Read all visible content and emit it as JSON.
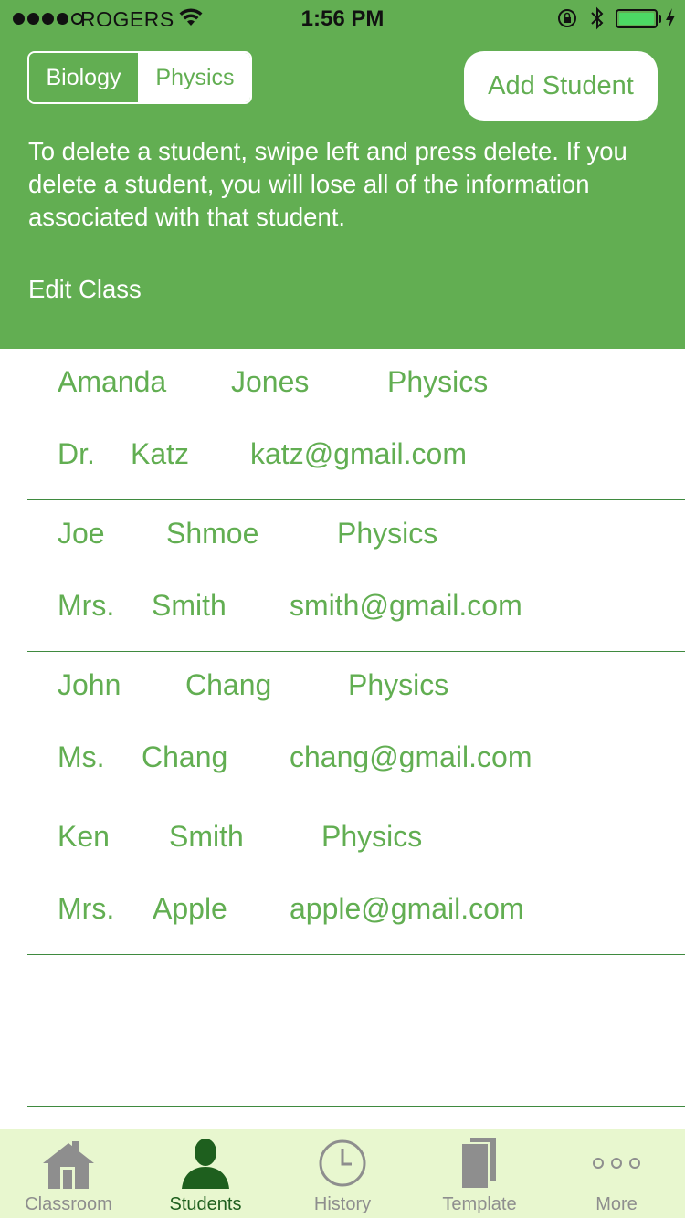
{
  "status_bar": {
    "carrier": "ROGERS",
    "time": "1:56 PM"
  },
  "segmented_control": {
    "options": [
      "Biology",
      "Physics"
    ],
    "selected": "Biology"
  },
  "header": {
    "add_button_label": "Add Student",
    "instructions": "To delete a student, swipe left and press delete. If you delete a student, you will lose all of the information associated with that student.",
    "edit_class_label": "Edit Class"
  },
  "students": [
    {
      "first_name": "Amanda",
      "last_name": "Jones",
      "class": "Physics",
      "teacher_title": "Dr.",
      "teacher_name": "Katz",
      "email": "katz@gmail.com"
    },
    {
      "first_name": "Joe",
      "last_name": "Shmoe",
      "class": "Physics",
      "teacher_title": "Mrs.",
      "teacher_name": "Smith",
      "email": "smith@gmail.com"
    },
    {
      "first_name": "John",
      "last_name": "Chang",
      "class": "Physics",
      "teacher_title": "Ms.",
      "teacher_name": "Chang",
      "email": "chang@gmail.com"
    },
    {
      "first_name": "Ken",
      "last_name": "Smith",
      "class": "Physics",
      "teacher_title": "Mrs.",
      "teacher_name": "Apple",
      "email": "apple@gmail.com"
    }
  ],
  "tab_bar": {
    "tabs": [
      {
        "label": "Classroom",
        "icon": "house-icon"
      },
      {
        "label": "Students",
        "icon": "person-icon"
      },
      {
        "label": "History",
        "icon": "clock-icon"
      },
      {
        "label": "Template",
        "icon": "documents-icon"
      },
      {
        "label": "More",
        "icon": "more-dots-icon"
      }
    ],
    "active": "Students"
  },
  "colors": {
    "header_green": "#62ae52",
    "text_green": "#62ae52",
    "tab_active": "#1e5f1e",
    "tab_inactive": "#8e8e8e",
    "tab_bar_bg": "#e8f7cf"
  }
}
